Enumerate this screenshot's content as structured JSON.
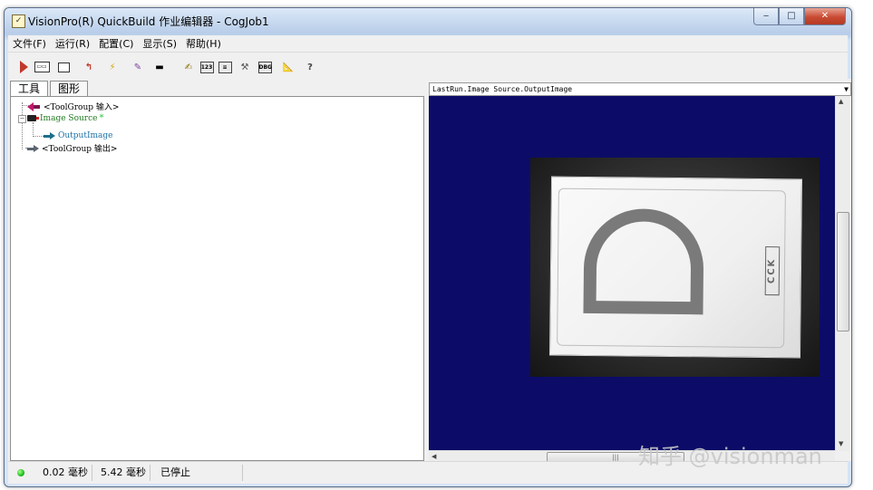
{
  "window": {
    "title": "VisionPro(R) QuickBuild 作业编辑器 - CogJob1",
    "app_icon": "job-icon",
    "buttons": {
      "minimize": "‒",
      "maximize": "□",
      "close": "✕"
    }
  },
  "menubar": [
    {
      "label": "文件(F)"
    },
    {
      "label": "运行(R)"
    },
    {
      "label": "配置(C)"
    },
    {
      "label": "显示(S)"
    },
    {
      "label": "帮助(H)"
    }
  ],
  "toolbar": {
    "icons": [
      "run-icon",
      "image-display-icon",
      "tool-icon",
      "upload-icon",
      "lightning-icon",
      "brush-icon",
      "stop-icon",
      "edit-icon",
      "counter-icon",
      "report-icon",
      "tools-icon",
      "debug-icon",
      "ruler-icon",
      "help-icon"
    ],
    "counter_text": "123",
    "debug_text": "DBG"
  },
  "tabs": [
    {
      "label": "工具",
      "active": true
    },
    {
      "label": "图形",
      "active": false
    }
  ],
  "tree": [
    {
      "label": "<ToolGroup 输入>",
      "icon": "input-arrow-icon",
      "color": "#000000"
    },
    {
      "label": "Image Source",
      "icon": "camera-icon",
      "color": "#1e7a1e",
      "status_dot": "*"
    },
    {
      "label": "OutputImage",
      "icon": "output-arrow-icon",
      "color": "#1a6fa6"
    },
    {
      "label": "<ToolGroup 输出>",
      "icon": "output-group-icon",
      "color": "#000000"
    }
  ],
  "display": {
    "selector": "LastRun.Image Source.OutputImage",
    "background": "#0c0c68",
    "image_text": "CCK"
  },
  "status": {
    "time1": "0.02 毫秒",
    "time2": "5.42 毫秒",
    "state": "已停止",
    "led_color": "#1fbf1f"
  },
  "watermark": "知乎 @visionman"
}
